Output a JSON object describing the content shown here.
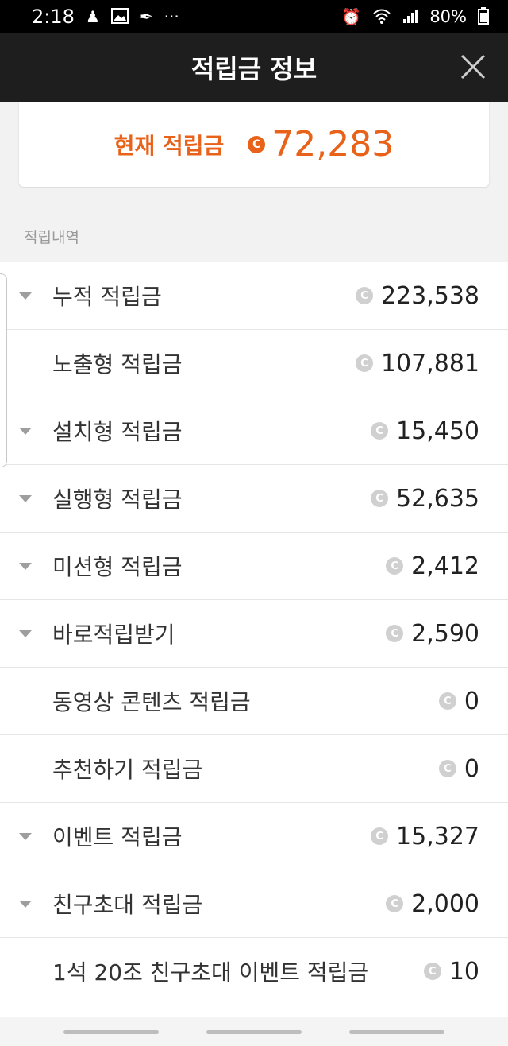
{
  "status_bar": {
    "time": "2:18",
    "battery": "80%",
    "icons_left": [
      "notification-icon",
      "image-icon",
      "app-icon",
      "more-icon"
    ],
    "icons_right": [
      "alarm-icon",
      "wifi-icon",
      "signal-icon",
      "battery-icon"
    ],
    "more_glyph": "···"
  },
  "header": {
    "title": "적립금 정보"
  },
  "balance": {
    "label": "현재 적립금",
    "coin_symbol": "C",
    "value": "72,283",
    "accent_color": "#e8621a"
  },
  "section": {
    "title": "적립내역"
  },
  "coin_symbol": "C",
  "rows": [
    {
      "label": "누적 적립금",
      "amount": "223,538",
      "expandable": true
    },
    {
      "label": "노출형 적립금",
      "amount": "107,881",
      "expandable": false
    },
    {
      "label": "설치형 적립금",
      "amount": "15,450",
      "expandable": true
    },
    {
      "label": "실행형 적립금",
      "amount": "52,635",
      "expandable": true
    },
    {
      "label": "미션형 적립금",
      "amount": "2,412",
      "expandable": true
    },
    {
      "label": "바로적립받기",
      "amount": "2,590",
      "expandable": true
    },
    {
      "label": "동영상 콘텐츠 적립금",
      "amount": "0",
      "expandable": false
    },
    {
      "label": "추천하기 적립금",
      "amount": "0",
      "expandable": false
    },
    {
      "label": "이벤트 적립금",
      "amount": "15,327",
      "expandable": true
    },
    {
      "label": "친구초대 적립금",
      "amount": "2,000",
      "expandable": true
    },
    {
      "label": "1석 20조 친구초대 이벤트 적립금",
      "amount": "10",
      "expandable": false
    }
  ]
}
